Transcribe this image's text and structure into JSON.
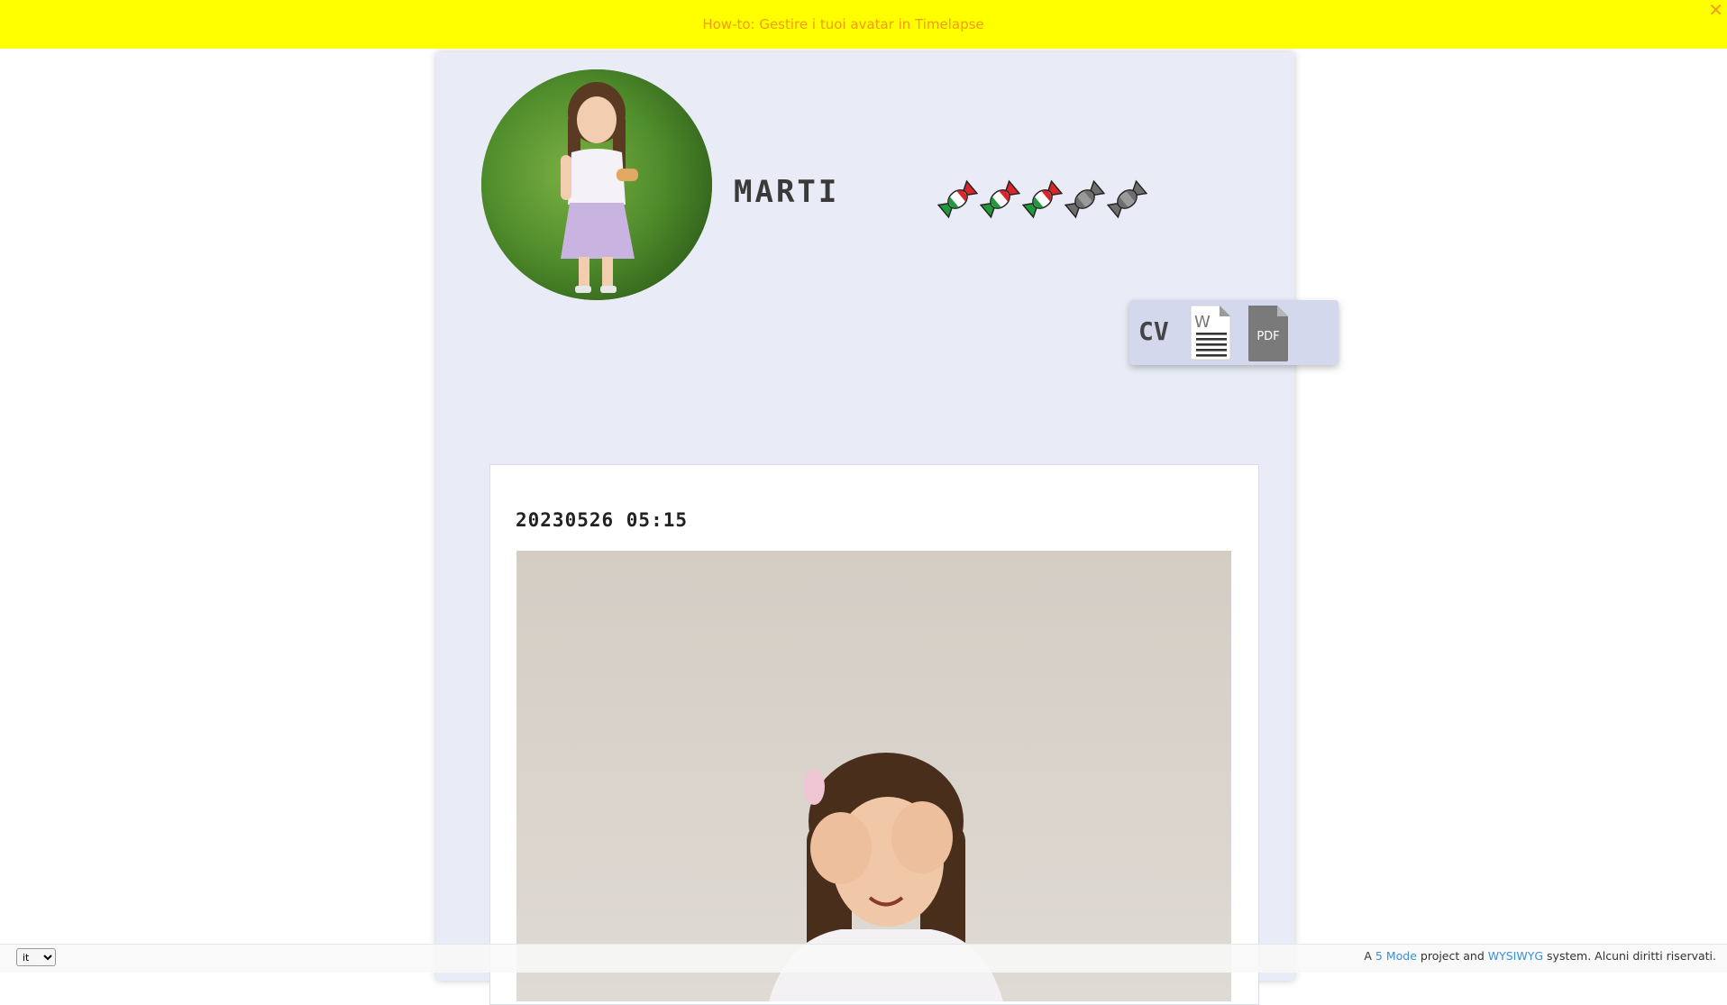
{
  "banner": {
    "link_text": "How-to: Gestire i tuoi avatar in Timelapse",
    "close_symbol": "✕",
    "background": "#ffff00",
    "link_color": "#f39c12"
  },
  "profile": {
    "name": "MARTI",
    "candies": [
      {
        "style": "italian-flag"
      },
      {
        "style": "italian-flag"
      },
      {
        "style": "italian-flag"
      },
      {
        "style": "grey"
      },
      {
        "style": "grey"
      }
    ],
    "panel_color": "#e9ecf6"
  },
  "cv": {
    "label": "CV",
    "word_icon": "word-document-icon",
    "pdf_icon": "pdf-document-icon",
    "pdf_text": "PDF"
  },
  "post": {
    "timestamp": "20230526 05:15"
  },
  "footer": {
    "language": "it",
    "prefix": "A",
    "link1": "5 Mode",
    "middle": "project and",
    "link2": "WYSIWYG",
    "suffix": "system. Alcuni diritti riservati."
  }
}
